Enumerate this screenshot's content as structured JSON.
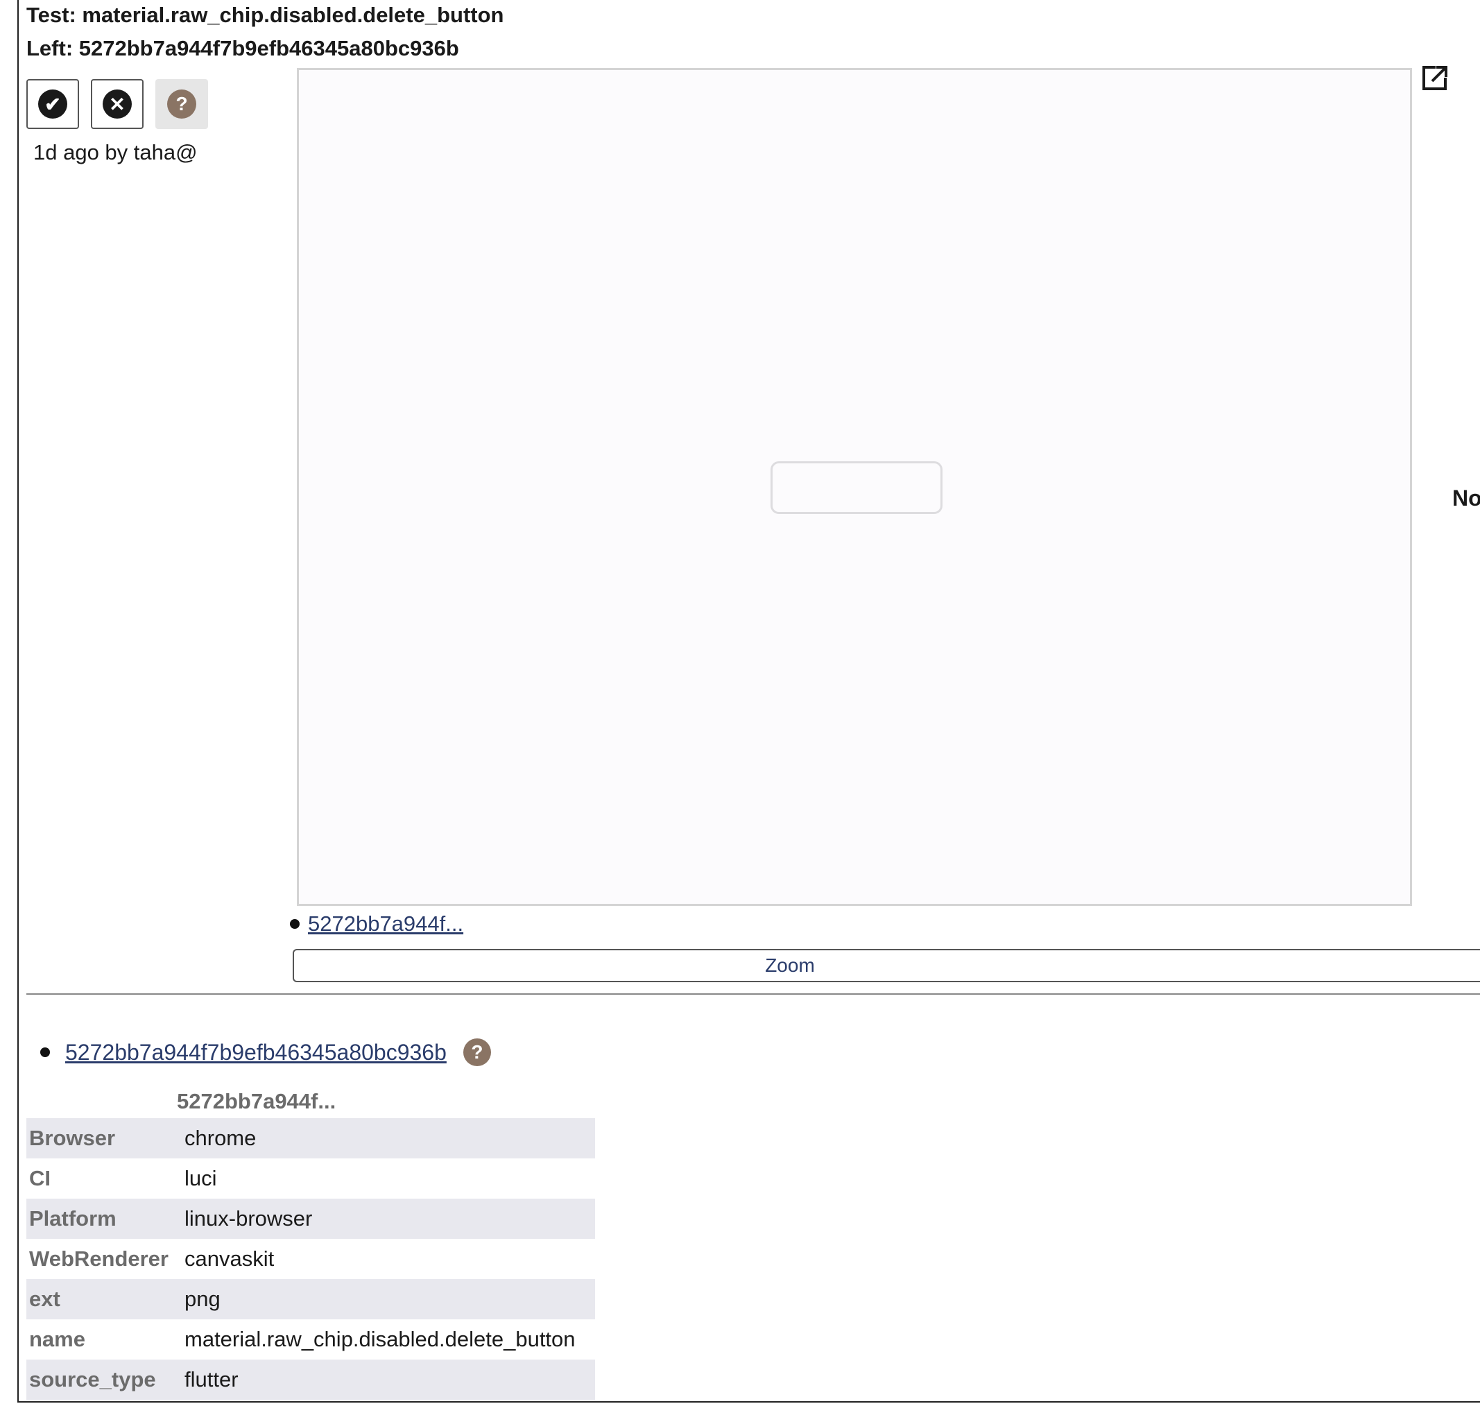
{
  "header": {
    "test_label": "Test: material.raw_chip.disabled.delete_button",
    "left_label": "Left: 5272bb7a944f7b9efb46345a80bc936b"
  },
  "triage": {
    "positive_glyph": "✔",
    "negative_glyph": "✕",
    "untriaged_glyph": "?",
    "meta": "1d ago by taha@"
  },
  "preview": {
    "right_partial_text": "No"
  },
  "digest_short_link": "5272bb7a944f...",
  "zoom_label": "Zoom",
  "details": {
    "digest_link": "5272bb7a944f7b9efb46345a80bc936b",
    "help_glyph": "?",
    "column_header": "5272bb7a944f...",
    "params": [
      {
        "key": "Browser",
        "value": "chrome"
      },
      {
        "key": "CI",
        "value": "luci"
      },
      {
        "key": "Platform",
        "value": "linux-browser"
      },
      {
        "key": "WebRenderer",
        "value": "canvaskit"
      },
      {
        "key": "ext",
        "value": "png"
      },
      {
        "key": "name",
        "value": "material.raw_chip.disabled.delete_button"
      },
      {
        "key": "source_type",
        "value": "flutter"
      }
    ]
  }
}
